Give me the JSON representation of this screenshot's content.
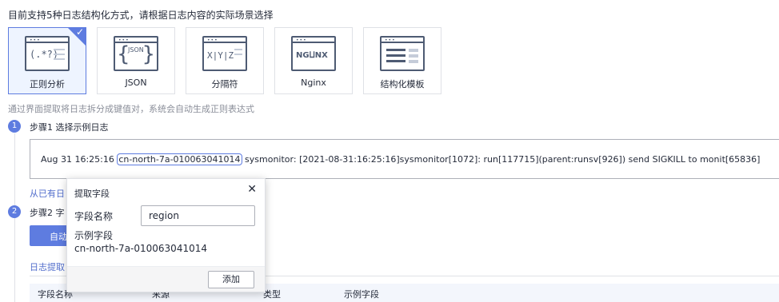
{
  "intro": "目前支持5种日志结构化方式，请根据日志内容的实际场景选择",
  "cards": [
    {
      "label": "正则分析",
      "icon": "regex-icon",
      "selected": true
    },
    {
      "label": "JSON",
      "icon": "json-icon",
      "selected": false
    },
    {
      "label": "分隔符",
      "icon": "delimiter-icon",
      "selected": false
    },
    {
      "label": "Nginx",
      "icon": "nginx-icon",
      "selected": false
    },
    {
      "label": "结构化模板",
      "icon": "template-icon",
      "selected": false
    }
  ],
  "card_icon_text": {
    "regex": "(.*?)",
    "json": "JSON",
    "delimiter": "X|Y|Z",
    "nginx": "NG⨿NX"
  },
  "hint": "通过界面提取将日志拆分成键值对，系统会自动生成正则表达式",
  "step1": {
    "num": "1",
    "label": "步骤1 选择示例日志"
  },
  "log": {
    "prefix": "Aug 31 16:25:16 ",
    "highlight": "cn-north-7a-010063041014",
    "suffix": " sysmonitor: [2021-08-31:16:25:16]sysmonitor[1072]: run[117715](parent:runsv[926]) send SIGKILL to monit[65836]"
  },
  "link_partial": "从已有日",
  "step2": {
    "num": "2",
    "label_partial": "步骤2 字"
  },
  "auto_btn_partial": "自动",
  "tab_partial": "日志提取",
  "table_headers": [
    "字段名称",
    "来源",
    "类型",
    "示例字段"
  ],
  "popup": {
    "title": "提取字段",
    "close": "✕",
    "name_label": "字段名称",
    "name_value": "region",
    "example_label": "示例字段",
    "example_value": "cn-north-7a-010063041014",
    "add_button": "添加"
  },
  "colors": {
    "accent": "#5e7ce0",
    "link": "#526ecc"
  }
}
